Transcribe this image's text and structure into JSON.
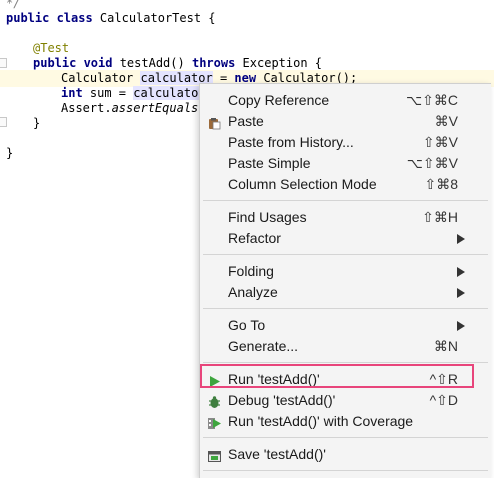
{
  "editor": {
    "lines": {
      "l0": "*/",
      "l1_kw": "public class",
      "l1_rest": " CalculatorTest {",
      "l3": "@Test",
      "l4_kw1": "public void",
      "l4_mid": " testAdd() ",
      "l4_kw2": "throws",
      "l4_rest": " Exception {",
      "l5_a": "Calculator ",
      "l5_b": "calculator",
      "l5_c": " = ",
      "l5_kw": "new",
      "l5_d": " Calculator();",
      "l6_kw": "int",
      "l6_a": " sum = ",
      "l6_b": "calculator",
      "l7_a": "Assert.",
      "l7_b": "assertEquals(",
      "l8": "}",
      "l10": "}"
    }
  },
  "menu": {
    "items": [
      {
        "label": "Copy Reference",
        "shortcut": "⌥⇧⌘C"
      },
      {
        "label": "Paste",
        "shortcut": "⌘V",
        "icon": "clipboard-icon"
      },
      {
        "label": "Paste from History...",
        "shortcut": "⇧⌘V"
      },
      {
        "label": "Paste Simple",
        "shortcut": "⌥⇧⌘V"
      },
      {
        "label": "Column Selection Mode",
        "shortcut": "⇧⌘8"
      },
      {
        "label": "Find Usages",
        "shortcut": "⇧⌘H"
      },
      {
        "label": "Refactor",
        "submenu": true
      },
      {
        "label": "Folding",
        "submenu": true
      },
      {
        "label": "Analyze",
        "submenu": true
      },
      {
        "label": "Go To",
        "submenu": true
      },
      {
        "label": "Generate...",
        "shortcut": "⌘N"
      },
      {
        "label": "Run 'testAdd()'",
        "shortcut": "^⇧R",
        "icon": "run-icon"
      },
      {
        "label": "Debug 'testAdd()'",
        "shortcut": "^⇧D",
        "icon": "debug-icon"
      },
      {
        "label": "Run 'testAdd()' with Coverage",
        "icon": "coverage-icon"
      },
      {
        "label": "Save 'testAdd()'",
        "icon": "save-config-icon"
      }
    ]
  },
  "colors": {
    "highlight_border": "#e8457b",
    "run_green": "#3ea53e",
    "menu_bg": "#f4f4f4"
  }
}
